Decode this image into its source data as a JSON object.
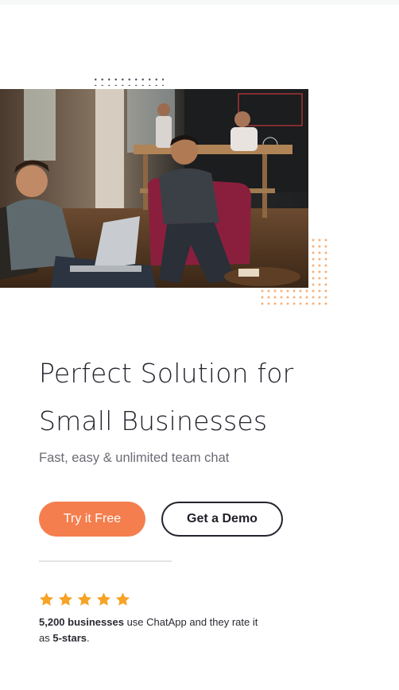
{
  "hero": {
    "headline_line1": "Perfect Solution for",
    "headline_line2": "Small Businesses",
    "subtitle": "Fast, easy & unlimited team chat"
  },
  "actions": {
    "primary_label": "Try it Free",
    "secondary_label": "Get a Demo"
  },
  "rating": {
    "stars": 5,
    "star_icon": "star-icon",
    "star_color": "#f7a325",
    "count_text": "5,200 businesses",
    "middle_text": " use ChatApp and they rate it as ",
    "rating_text": "5-stars",
    "end_text": "."
  },
  "colors": {
    "accent": "#f47e4d",
    "dark": "#23232d",
    "muted": "#6b6b75"
  }
}
